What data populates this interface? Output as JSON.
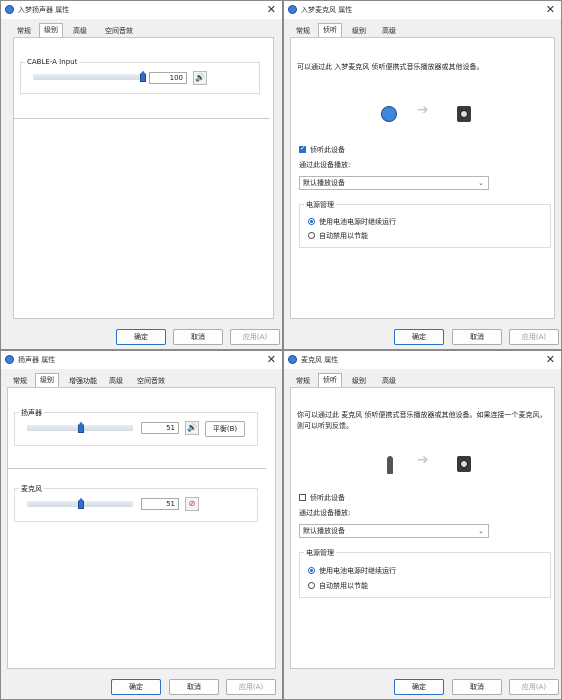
{
  "colors": {
    "desktop": "#b9b77a",
    "accent": "#2a6fc9"
  },
  "windows": {
    "tl": {
      "title": "入梦扬声器 属性",
      "tabs": [
        "常规",
        "级别",
        "高级",
        "空间音效"
      ],
      "slider_label": "CABLE-A Input",
      "slider_value": "100",
      "slider_level": 100
    },
    "tr": {
      "title": "入梦麦克风 属性",
      "tabs": [
        "常规",
        "侦听",
        "级别",
        "高级"
      ],
      "description": "可以通过此 入梦麦克风 侦听便携式音乐播放器或其他设备。",
      "listen_checkbox": "侦听此设备",
      "playback_label": "通过此设备播放:",
      "playback_value": "默认播放设备",
      "power_label": "电源管理",
      "radio1": "使用电池电源时继续运行",
      "radio2": "自动禁用以节能"
    },
    "bl": {
      "title": "扬声器 属性",
      "tabs": [
        "常规",
        "级别",
        "增强功能",
        "高级",
        "空间音效"
      ],
      "speaker_label": "扬声器",
      "speaker_value": "51",
      "speaker_level": 51,
      "balance_button": "平衡(B)",
      "mic_label": "麦克风",
      "mic_value": "51",
      "mic_level": 51
    },
    "br": {
      "title": "麦克风 属性",
      "tabs": [
        "常规",
        "侦听",
        "级别",
        "高级"
      ],
      "description": "你可以通过此 麦克风 侦听便携式音乐播放器或其他设备。如果连接一个麦克风，则可以听到反馈。",
      "listen_checkbox": "侦听此设备",
      "playback_label": "通过此设备播放:",
      "playback_value": "默认播放设备",
      "power_label": "电源管理",
      "radio1": "使用电池电源时继续运行",
      "radio2": "自动禁用以节能"
    }
  },
  "buttons": {
    "ok": "确定",
    "cancel": "取消",
    "apply": "应用(A)"
  }
}
